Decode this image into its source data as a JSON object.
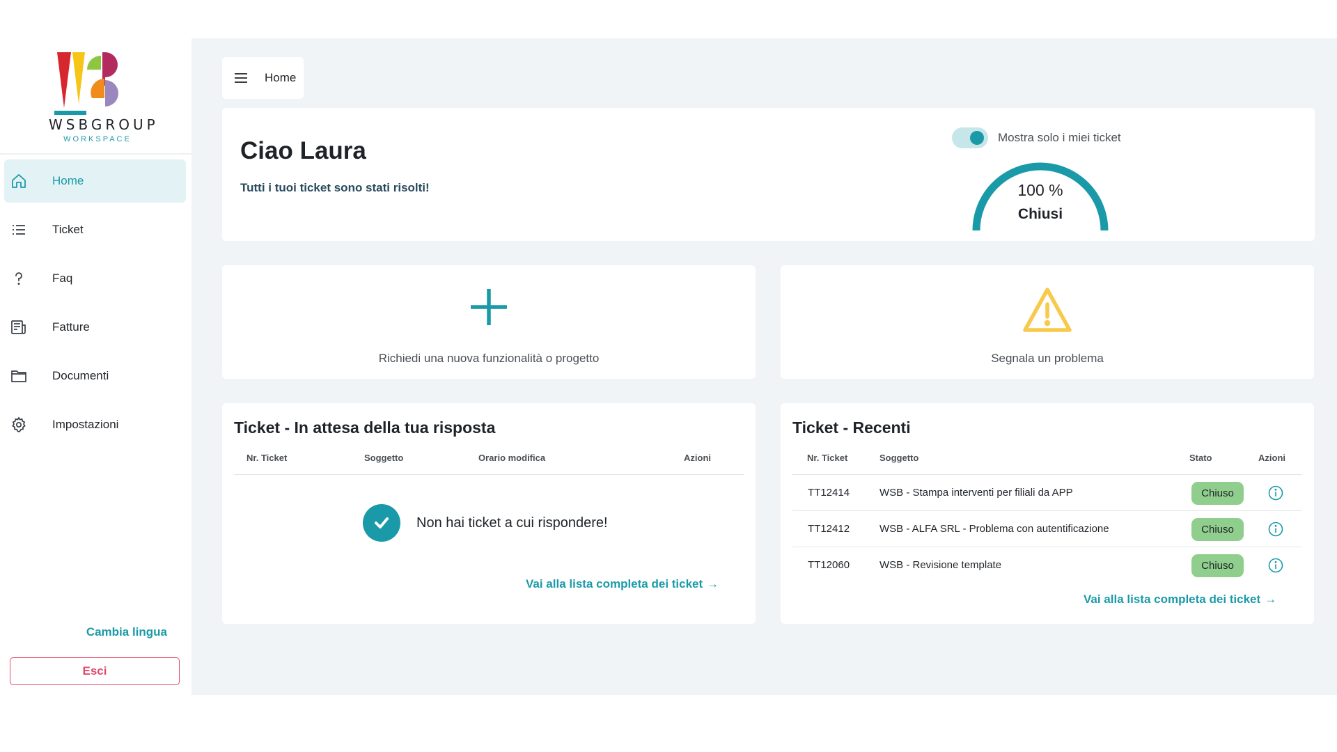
{
  "brand": {
    "logo_text": "WSBGROUP",
    "logo_sub": "WORKSPACE",
    "colors": {
      "accent": "#1a9aa8",
      "danger": "#e24a6b",
      "status_closed": "#8fce8d"
    }
  },
  "sidebar": {
    "items": [
      {
        "label": "Home",
        "icon": "home-icon",
        "active": true
      },
      {
        "label": "Ticket",
        "icon": "list-icon"
      },
      {
        "label": "Faq",
        "icon": "question-icon"
      },
      {
        "label": "Fatture",
        "icon": "invoice-icon"
      },
      {
        "label": "Documenti",
        "icon": "folder-icon"
      },
      {
        "label": "Impostazioni",
        "icon": "gear-icon"
      }
    ],
    "language_link": "Cambia lingua",
    "logout_label": "Esci"
  },
  "breadcrumb": {
    "label": "Home"
  },
  "welcome": {
    "title": "Ciao Laura",
    "subtitle": "Tutti i tuoi ticket sono stati risolti!",
    "toggle_label": "Mostra solo i miei ticket",
    "toggle_on": true,
    "gauge_value": "100 %",
    "gauge_fraction": 1.0,
    "gauge_label": "Chiusi"
  },
  "actions": {
    "new_request": "Richiedi una nuova funzionalità o progetto",
    "report_problem": "Segnala un problema"
  },
  "awaiting": {
    "title": "Ticket - In attesa della tua risposta",
    "headers": {
      "number": "Nr. Ticket",
      "subject": "Soggetto",
      "modified": "Orario modifica",
      "actions": "Azioni"
    },
    "empty_text": "Non hai ticket a cui rispondere!",
    "link": "Vai alla lista completa dei ticket"
  },
  "recent": {
    "title": "Ticket - Recenti",
    "headers": {
      "number": "Nr. Ticket",
      "subject": "Soggetto",
      "status": "Stato",
      "actions": "Azioni"
    },
    "rows": [
      {
        "number": "TT12414",
        "subject": "WSB - Stampa interventi per filiali da APP",
        "status": "Chiuso"
      },
      {
        "number": "TT12412",
        "subject": "WSB - ALFA SRL - Problema con autentificazione",
        "status": "Chiuso"
      },
      {
        "number": "TT12060",
        "subject": "WSB - Revisione template",
        "status": "Chiuso"
      }
    ],
    "link": "Vai alla lista completa dei ticket"
  }
}
